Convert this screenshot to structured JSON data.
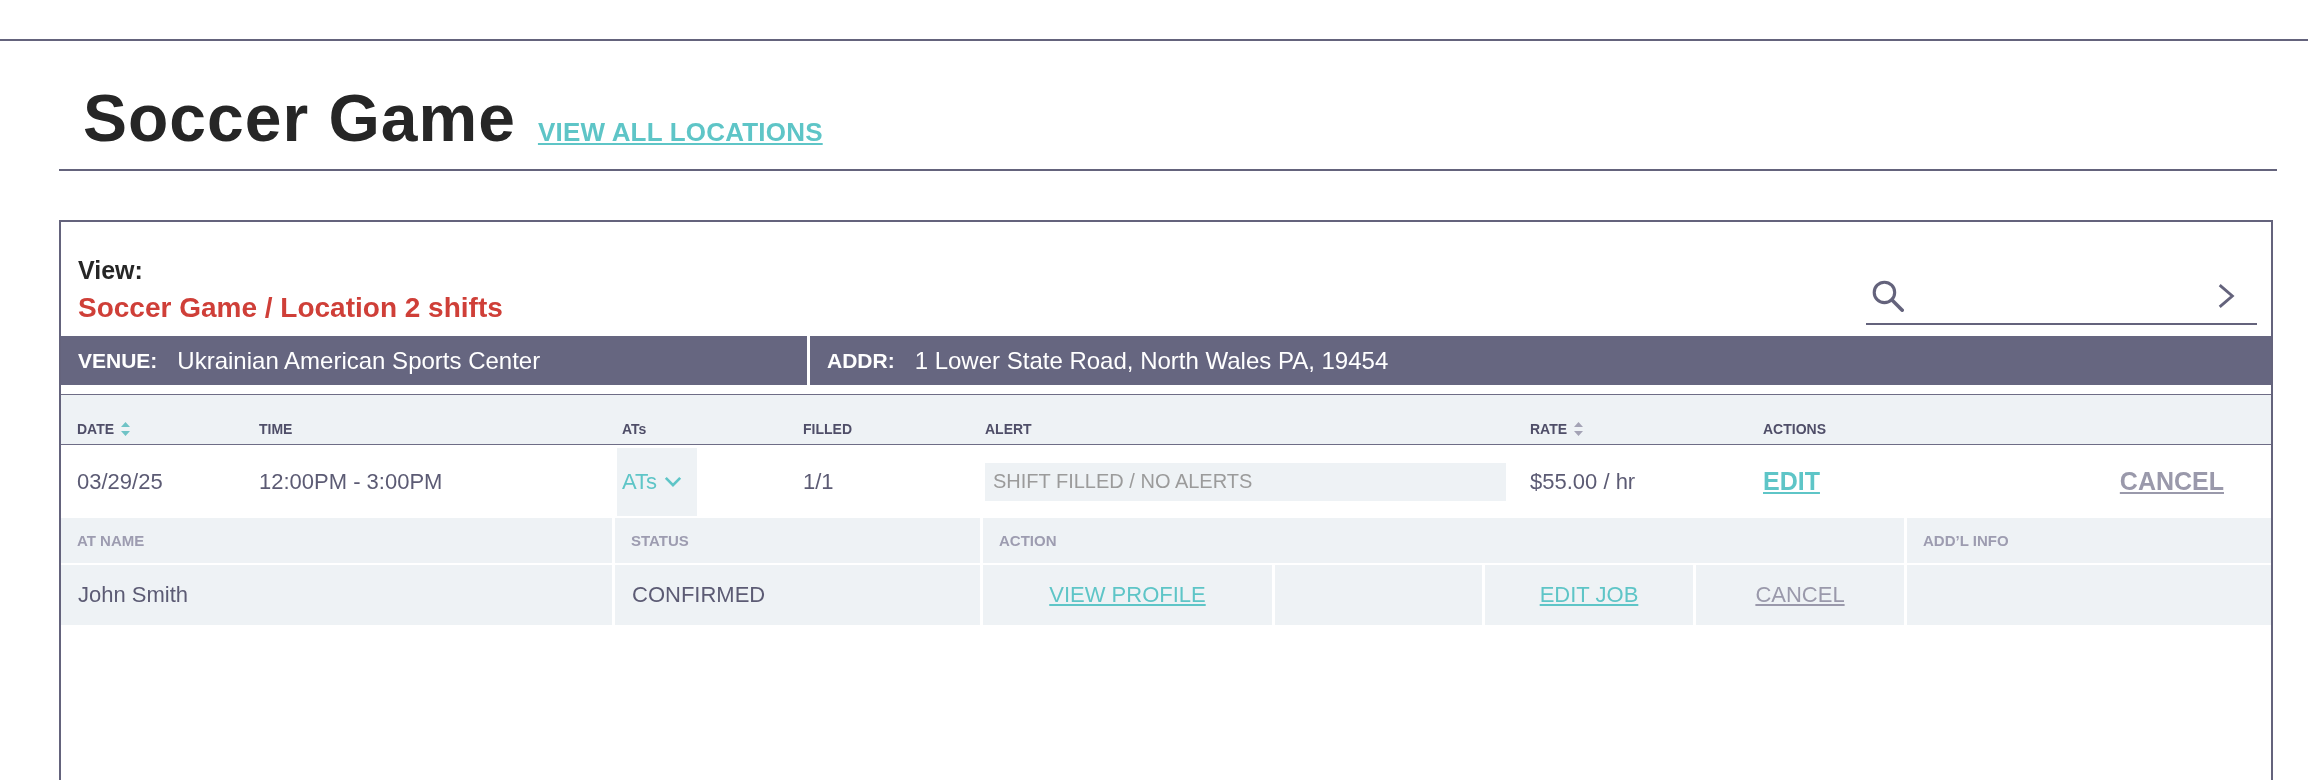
{
  "header": {
    "title": "Soccer Game",
    "link": "VIEW ALL LOCATIONS"
  },
  "panel": {
    "view_label": "View:",
    "view_value": "Soccer Game / Location 2 shifts"
  },
  "venue_bar": [
    {
      "label": "VENUE:",
      "value": "Ukrainian American Sports Center"
    },
    {
      "label": "ADDR:",
      "value": "1 Lower State Road, North Wales PA, 19454"
    }
  ],
  "shifts": {
    "columns": [
      {
        "label": "DATE",
        "sort": {
          "active": true
        }
      },
      {
        "label": "TIME"
      },
      {
        "label": "ATs"
      },
      {
        "label": "FILLED"
      },
      {
        "label": "ALERT"
      },
      {
        "label": "RATE",
        "sort": {
          "active": false
        }
      },
      {
        "label": "ACTIONS"
      }
    ],
    "rows": [
      {
        "date": "03/29/25",
        "time": "12:00PM - 3:00PM",
        "ats": {
          "label": "ATs",
          "expanded": true
        },
        "filled": "1/1",
        "alert": "SHIFT FILLED / NO ALERTS",
        "rate": "$55.00 / hr",
        "actions": [
          {
            "label": "EDIT",
            "kind": "primary"
          },
          {
            "label": "CANCEL",
            "kind": "secondary"
          }
        ],
        "at_table": {
          "columns": [
            "AT NAME",
            "STATUS",
            "ACTION",
            "ADD’L INFO"
          ],
          "rows": [
            {
              "name": "John Smith",
              "status": "CONFIRMED",
              "actions": [
                {
                  "label": "VIEW PROFILE",
                  "kind": "primary"
                },
                {
                  "kind": "blank"
                },
                {
                  "label": "EDIT JOB",
                  "kind": "primary"
                },
                {
                  "label": "CANCEL",
                  "kind": "secondary"
                }
              ]
            }
          ]
        }
      }
    ]
  }
}
